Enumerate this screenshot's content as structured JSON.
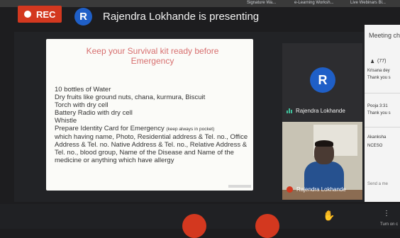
{
  "browser_tabs": [
    "Signature Wa...",
    "e-Learning Worksh...",
    "Live Webinars Bl..."
  ],
  "recording": {
    "label": "REC",
    "color": "#d3381f"
  },
  "presenter": {
    "initial": "R",
    "status_text": "Rajendra Lokhande is presenting"
  },
  "slide": {
    "title": "Keep your Survival kit ready before Emergency",
    "items": [
      "10 bottles of Water",
      "Dry fruits like ground nuts, chana, kurmura, Biscuit",
      "Torch with dry cell",
      "Battery Radio with dry cell",
      "Whistle"
    ],
    "id_card_text": "Prepare Identity Card for Emergency",
    "id_card_note": "(keep always in pocket)",
    "id_card_detail": "which having name, Photo, Residential address & Tel. no., Office Address & Tel. no. Native Address & Tel. no., Relative Address & Tel. no., blood group, Name of the Disease and Name of the medicine or anything which have allergy"
  },
  "tiles": [
    {
      "initial": "R",
      "name": "Rajendra Lokhande",
      "audio": "speaking"
    },
    {
      "name": "Rajendra Lokhande",
      "audio": "muted"
    }
  ],
  "side_panel": {
    "title": "Meeting ch",
    "participants_count": "(77)",
    "messages": [
      {
        "sender": "Krisana dey",
        "text": "Thank you s"
      },
      {
        "sender": "Pooja 3:31",
        "text": "Thank you s"
      },
      {
        "sender": "Akanksha",
        "text": "NCESO"
      }
    ],
    "input_placeholder": "Send a me"
  },
  "bottom_bar": {
    "right_label": "Turn on c"
  },
  "colors": {
    "accent_blue": "#1f5fc7",
    "record_red": "#d3381f",
    "audio_green": "#3fbf9a",
    "slide_title": "#d76f6f"
  }
}
